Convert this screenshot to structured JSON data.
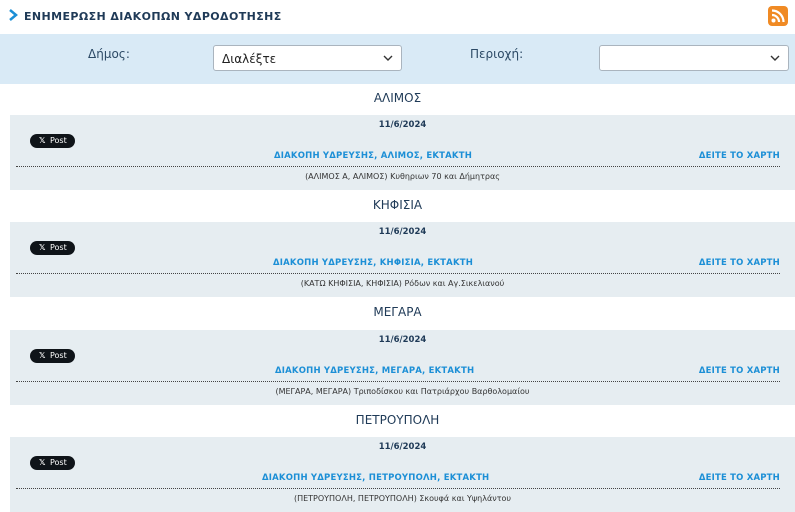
{
  "header": {
    "title": "ΕΝΗΜΕΡΩΣΗ ΔΙΑΚΟΠΩΝ ΥΔΡΟΔΟΤΗΣΗΣ",
    "accent": "#1c8fd6",
    "rss_color": "#f08a24"
  },
  "filters": {
    "municipality_label": "Δήμος:",
    "municipality_value": "Διαλέξτε",
    "area_label": "Περιοχή:",
    "area_value": ""
  },
  "groups": [
    {
      "title": "ΑΛΙΜΟΣ",
      "date": "11/6/2024",
      "share": "Post",
      "link": "ΔΙΑΚΟΠΗ ΥΔΡΕΥΣΗΣ, ΑΛΙΜΟΣ, ΕΚΤΑΚΤΗ",
      "map": "ΔΕΙΤΕ ΤΟ ΧΑΡΤΗ",
      "address": "(ΑΛΙΜΟΣ Α, ΑΛΙΜΟΣ) Κυθηριων 70 και Δήμητρας"
    },
    {
      "title": "ΚΗΦΙΣΙΑ",
      "date": "11/6/2024",
      "share": "Post",
      "link": "ΔΙΑΚΟΠΗ ΥΔΡΕΥΣΗΣ, ΚΗΦΙΣΙΑ, ΕΚΤΑΚΤΗ",
      "map": "ΔΕΙΤΕ ΤΟ ΧΑΡΤΗ",
      "address": "(ΚΑΤΩ ΚΗΦΙΣΙΑ, ΚΗΦΙΣΙΑ) Ρόδων και Αγ.Σικελιανού"
    },
    {
      "title": "ΜΕΓΑΡΑ",
      "date": "11/6/2024",
      "share": "Post",
      "link": "ΔΙΑΚΟΠΗ ΥΔΡΕΥΣΗΣ, ΜΕΓΑΡΑ, ΕΚΤΑΚΤΗ",
      "map": "ΔΕΙΤΕ ΤΟ ΧΑΡΤΗ",
      "address": "(ΜΕΓΑΡΑ, ΜΕΓΑΡΑ) Τριποδίσκου και Πατριάρχου Βαρθολομαίου"
    },
    {
      "title": "ΠΕΤΡΟΥΠΟΛΗ",
      "date": "11/6/2024",
      "share": "Post",
      "link": "ΔΙΑΚΟΠΗ ΥΔΡΕΥΣΗΣ, ΠΕΤΡΟΥΠΟΛΗ, ΕΚΤΑΚΤΗ",
      "map": "ΔΕΙΤΕ ΤΟ ΧΑΡΤΗ",
      "address": "(ΠΕΤΡΟΥΠΟΛΗ, ΠΕΤΡΟΥΠΟΛΗ) Σκουφά και Υψηλάντου"
    }
  ]
}
